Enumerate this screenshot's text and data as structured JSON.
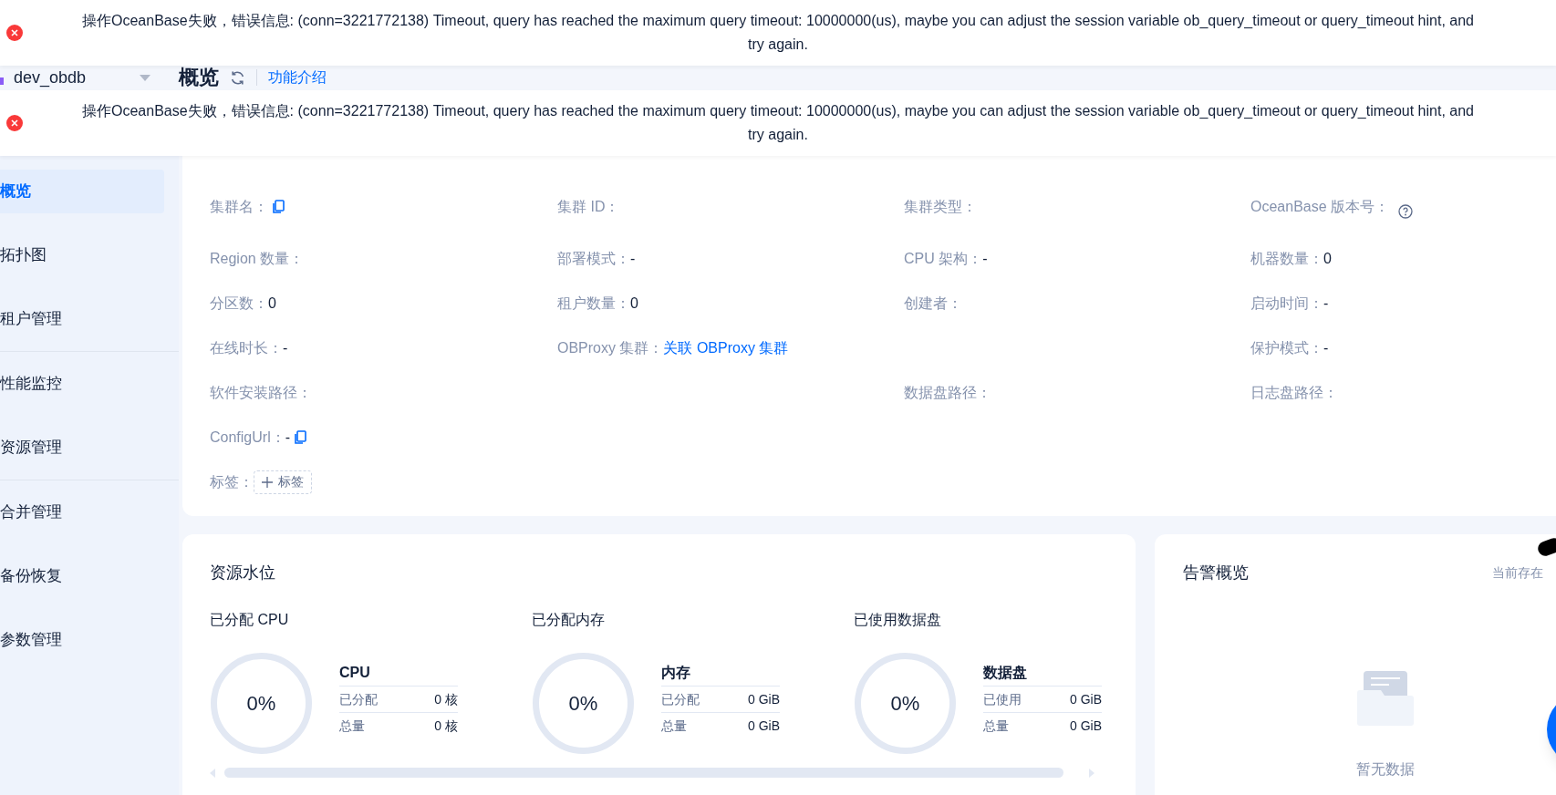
{
  "toasts": [
    {
      "kind": "error",
      "message": "操作OceanBase失败，错误信息: (conn=3221772138) Timeout, query has reached the maximum query timeout: 10000000(us), maybe you can adjust the session variable ob_query_timeout or query_timeout hint, and try again."
    },
    {
      "kind": "error",
      "message": "操作OceanBase失败，错误信息: (conn=3221772138) Timeout, query has reached the maximum query timeout: 10000000(us), maybe you can adjust the session variable ob_query_timeout or query_timeout hint, and try again."
    }
  ],
  "cluster_selector": {
    "value": "dev_obdb"
  },
  "page_header": {
    "title": "概览",
    "link": "功能介绍"
  },
  "sidebar": {
    "groups": [
      [
        {
          "label": "概览",
          "selected": true
        },
        {
          "label": "拓扑图",
          "selected": false
        },
        {
          "label": "租户管理",
          "selected": false
        }
      ],
      [
        {
          "label": "性能监控",
          "selected": false
        },
        {
          "label": "资源管理",
          "selected": false
        }
      ],
      [
        {
          "label": "合并管理",
          "selected": false
        },
        {
          "label": "备份恢复",
          "selected": false
        },
        {
          "label": "参数管理",
          "selected": false
        }
      ]
    ]
  },
  "basic_info": {
    "rows": [
      [
        {
          "label": "集群名：",
          "kind": "copy"
        },
        {
          "label": "集群 ID："
        },
        {
          "label": "集群类型："
        },
        {
          "label": "OceanBase 版本号：",
          "kind": "help"
        }
      ],
      [
        {
          "label": "Region 数量："
        },
        {
          "label": "部署模式：",
          "value": "-"
        },
        {
          "label": "CPU 架构：",
          "value": "-"
        },
        {
          "label": "机器数量：",
          "value": "0"
        }
      ],
      [
        {
          "label": "分区数：",
          "value": "0"
        },
        {
          "label": "租户数量：",
          "value": "0"
        },
        {
          "label": "创建者："
        },
        {
          "label": "启动时间：",
          "value": "-"
        }
      ],
      [
        {
          "label": "在线时长：",
          "value": "-"
        },
        {
          "label": "OBProxy 集群：",
          "link": "关联 OBProxy 集群"
        },
        null,
        {
          "label": "保护模式：",
          "value": "-"
        }
      ],
      [
        {
          "label": "软件安装路径："
        },
        null,
        {
          "label": "数据盘路径："
        },
        {
          "label": "日志盘路径："
        }
      ],
      [
        {
          "label": "ConfigUrl：",
          "value": "-",
          "kind": "copy"
        },
        null,
        null,
        null
      ],
      [
        {
          "label": "标签：",
          "button": "标签"
        },
        null,
        null,
        null
      ]
    ]
  },
  "resource_usage": {
    "title": "资源水位",
    "gauges": [
      {
        "title": "已分配 CPU",
        "percent": "0%",
        "level": 0,
        "name": "CPU",
        "rows": [
          {
            "label": "已分配",
            "value": "0 核"
          },
          {
            "label": "总量",
            "value": "0 核"
          }
        ]
      },
      {
        "title": "已分配内存",
        "percent": "0%",
        "level": 0,
        "name": "内存",
        "rows": [
          {
            "label": "已分配",
            "value": "0 GiB"
          },
          {
            "label": "总量",
            "value": "0 GiB"
          }
        ]
      },
      {
        "title": "已使用数据盘",
        "percent": "0%",
        "level": 0,
        "name": "数据盘",
        "rows": [
          {
            "label": "已使用",
            "value": "0 GiB"
          },
          {
            "label": "总量",
            "value": "0 GiB"
          }
        ]
      }
    ]
  },
  "alert_overview": {
    "title": "告警概览",
    "note": "当前存在",
    "empty_text": "暂无数据"
  }
}
